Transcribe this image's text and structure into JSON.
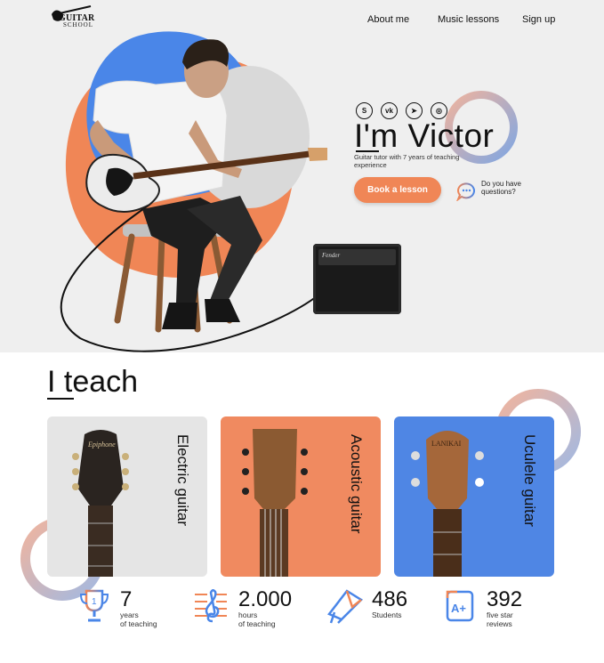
{
  "nav": {
    "logo_title": "GUITAR",
    "logo_sub": "SCHOOL",
    "items": [
      "About me",
      "Music lessons",
      "Sign up"
    ]
  },
  "hero": {
    "social": [
      {
        "icon": "skype-icon",
        "glyph": "S"
      },
      {
        "icon": "vk-icon",
        "glyph": "vk"
      },
      {
        "icon": "telegram-icon",
        "glyph": "➤"
      },
      {
        "icon": "instagram-icon",
        "glyph": "◎"
      }
    ],
    "name": "I'm Victor",
    "tagline": "Guitar tutor with 7 years of teaching experience",
    "cta": "Book a lesson",
    "question": "Do you have questions?"
  },
  "teach": {
    "title": "I teach",
    "cards": [
      {
        "label": "Electric guitar",
        "bg": "#e5e5e5"
      },
      {
        "label": "Acoustic guitar",
        "bg": "#f08a60"
      },
      {
        "label": "Uculele guitar",
        "bg": "#4f86e4"
      }
    ]
  },
  "stats": [
    {
      "num": "7",
      "label": "years\nof teaching",
      "icon": "trophy-icon"
    },
    {
      "num": "2.000",
      "label": "hours\nof teaching",
      "icon": "treble-clef-icon"
    },
    {
      "num": "486",
      "label": "Students",
      "icon": "graduation-cap-icon"
    },
    {
      "num": "392",
      "label": "five star\nreviews",
      "icon": "a-plus-icon"
    }
  ],
  "colors": {
    "accent": "#f08656",
    "blue": "#4a86e8"
  }
}
